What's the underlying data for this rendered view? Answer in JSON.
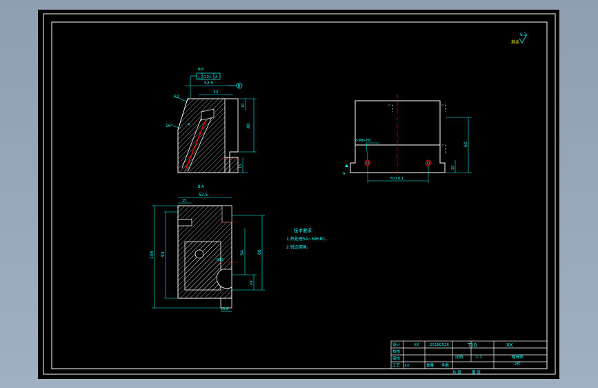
{
  "colors": {
    "background": "#a7b5c6",
    "paper": "#000000",
    "border": "#ffffff",
    "cyan": "#00ffff",
    "red": "#ff0000",
    "blue": "#6aa0ff",
    "yellow": "#ffff00"
  },
  "roughness": {
    "label": "其余",
    "value": "6.3"
  },
  "section_a": {
    "name": "B-B",
    "tolerance_symbol": "⊥",
    "tolerance_value": "0.01",
    "tolerance_datum": "A",
    "dim_width": "52.5",
    "dim_inner": "32",
    "dim_chamfer": "R2",
    "dim_angle": "16°",
    "dim_small": "4",
    "dim_height": "80",
    "dim_top": "10",
    "dim_bottom": "15",
    "datum_label": "B"
  },
  "side_view": {
    "hole_label": "2-M6-7H",
    "dim_spacing": "70±0.1",
    "dim_height": "60",
    "dim_right": "10",
    "datum_label": "A"
  },
  "section_b": {
    "name": "B-A",
    "dim_width": "52.5",
    "dim_slot": "15",
    "dim_total": "108",
    "dim_left": "93",
    "dim_mid": "54",
    "dim_right": "80",
    "dim_small": "24",
    "dim_radius": "R13",
    "dim_bottom": "13.6"
  },
  "technical_notes": {
    "title": "技术要求",
    "lines": [
      "1.热处理54~58HRC。",
      "2.锐边倒角。"
    ]
  },
  "title_block": {
    "designer_label": "设计",
    "designer": "XX",
    "date": "20180526",
    "material": "T10",
    "company": "XX",
    "check_label": "校核",
    "scale_label": "比例",
    "scale": "1:1",
    "part_name": "暗滑块",
    "review_label": "审核",
    "qty_label": "件数",
    "qty": "2件",
    "process_label": "工艺",
    "sheet_label": "共 张",
    "sheet_no": "第 张",
    "sign": "XX",
    "weight_label": "重量"
  }
}
